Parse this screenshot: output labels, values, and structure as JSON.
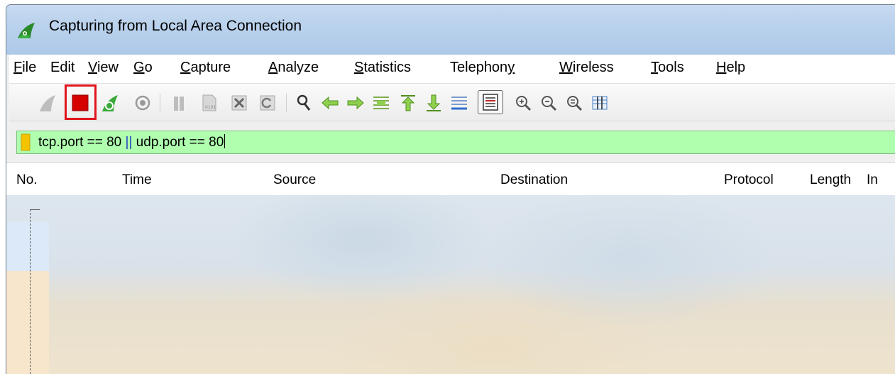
{
  "window": {
    "title": "Capturing from Local Area Connection"
  },
  "menu": {
    "items": [
      {
        "label": "File",
        "underline": "F",
        "rest": "ile"
      },
      {
        "label": "Edit",
        "underline": "",
        "rest": "Edit"
      },
      {
        "label": "View",
        "underline": "V",
        "rest": "iew"
      },
      {
        "label": "Go",
        "underline": "G",
        "rest": "o"
      },
      {
        "label": "Capture",
        "underline": "C",
        "rest": "apture"
      },
      {
        "label": "Analyze",
        "underline": "A",
        "rest": "nalyze"
      },
      {
        "label": "Statistics",
        "underline": "S",
        "rest": "tatistics"
      },
      {
        "label": "Telephony",
        "pre": "Telephon",
        "underline": "y",
        "rest": ""
      },
      {
        "label": "Wireless",
        "underline": "W",
        "rest": "ireless"
      },
      {
        "label": "Tools",
        "underline": "T",
        "rest": "ools"
      },
      {
        "label": "Help",
        "underline": "H",
        "rest": "elp"
      }
    ]
  },
  "toolbar": {
    "buttons": [
      "start-capture-icon",
      "stop-capture-icon",
      "restart-capture-icon",
      "capture-options-icon",
      "open-file-icon",
      "save-file-icon",
      "close-file-icon",
      "reload-file-icon",
      "find-packet-icon",
      "go-back-icon",
      "go-forward-icon",
      "go-to-packet-icon",
      "go-first-packet-icon",
      "go-last-packet-icon",
      "auto-scroll-icon",
      "colorize-icon",
      "zoom-in-icon",
      "zoom-out-icon",
      "normal-size-icon",
      "resize-columns-icon"
    ],
    "highlighted_button": "stop-capture-icon",
    "highlight_color": "#e0141c"
  },
  "filter": {
    "value": "tcp.port == 80 || udp.port == 80",
    "part1": "tcp.port == 80 ",
    "operator": "||",
    "part2": " udp.port == 80",
    "background_color": "#afffaf"
  },
  "packet_list": {
    "columns": [
      "No.",
      "Time",
      "Source",
      "Destination",
      "Protocol",
      "Length",
      "In"
    ]
  },
  "colors": {
    "titlebar": "#b9d1ec",
    "filter_valid": "#afffaf",
    "selected_row": "#dbe9f8",
    "tcp_row": "#f7e6cb"
  }
}
